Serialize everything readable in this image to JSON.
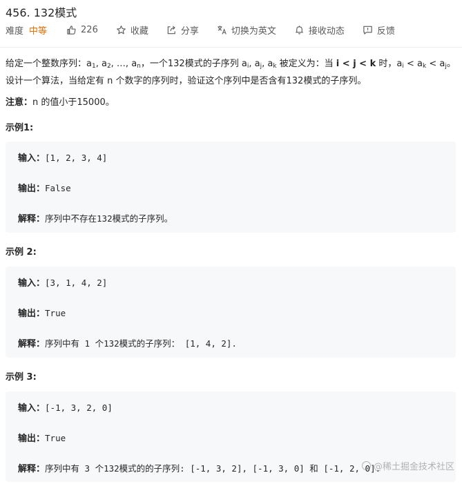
{
  "problem": {
    "title": "456. 132模式"
  },
  "toolbar": {
    "difficulty_label": "难度",
    "difficulty_value": "中等",
    "likes": "226",
    "favorite": "收藏",
    "share": "分享",
    "translate": "切换为英文",
    "notifications": "接收动态",
    "feedback": "反馈",
    "difficulty_color": "#ef6c00"
  },
  "description": {
    "p1_a": "给定一个整数序列：a",
    "p1_b": ", a",
    "p1_c": ", …, a",
    "p1_d": "，一个132模式的子序列 a",
    "p1_e": ", a",
    "p1_f": ", a",
    "p1_g": " 被定义为：当 ",
    "p1_h": "i < j < k",
    "p1_i": " 时，a",
    "p1_j": " < a",
    "p1_k": " < a",
    "p1_l": "。设计一个算法，当给定有 n 个数字的序列时，验证这个序列中是否含有132模式的子序列。",
    "sub1": "1",
    "sub2": "2",
    "subn": "n",
    "subi": "i",
    "subj": "j",
    "subk": "k"
  },
  "note": {
    "label": "注意：",
    "text": "n 的值小于15000。"
  },
  "examples": [
    {
      "title": "示例1:",
      "input_label": "输入：",
      "input": "[1, 2, 3, 4]",
      "output_label": "输出：",
      "output": "False",
      "explain_label": "解释：",
      "explain": "序列中不存在132模式的子序列。"
    },
    {
      "title": "示例 2:",
      "input_label": "输入：",
      "input": "[3, 1, 4, 2]",
      "output_label": "输出：",
      "output": "True",
      "explain_label": "解释：",
      "explain": "序列中有 1 个132模式的子序列： [1, 4, 2]."
    },
    {
      "title": "示例 3:",
      "input_label": "输入：",
      "input": "[-1, 3, 2, 0]",
      "output_label": "输出：",
      "output": "True",
      "explain_label": "解释：",
      "explain": "序列中有 3 个132模式的的子序列: [-1, 3, 2], [-1, 3, 0] 和 [-1, 2, 0]."
    }
  ],
  "watermark": "@稀土掘金技术社区"
}
